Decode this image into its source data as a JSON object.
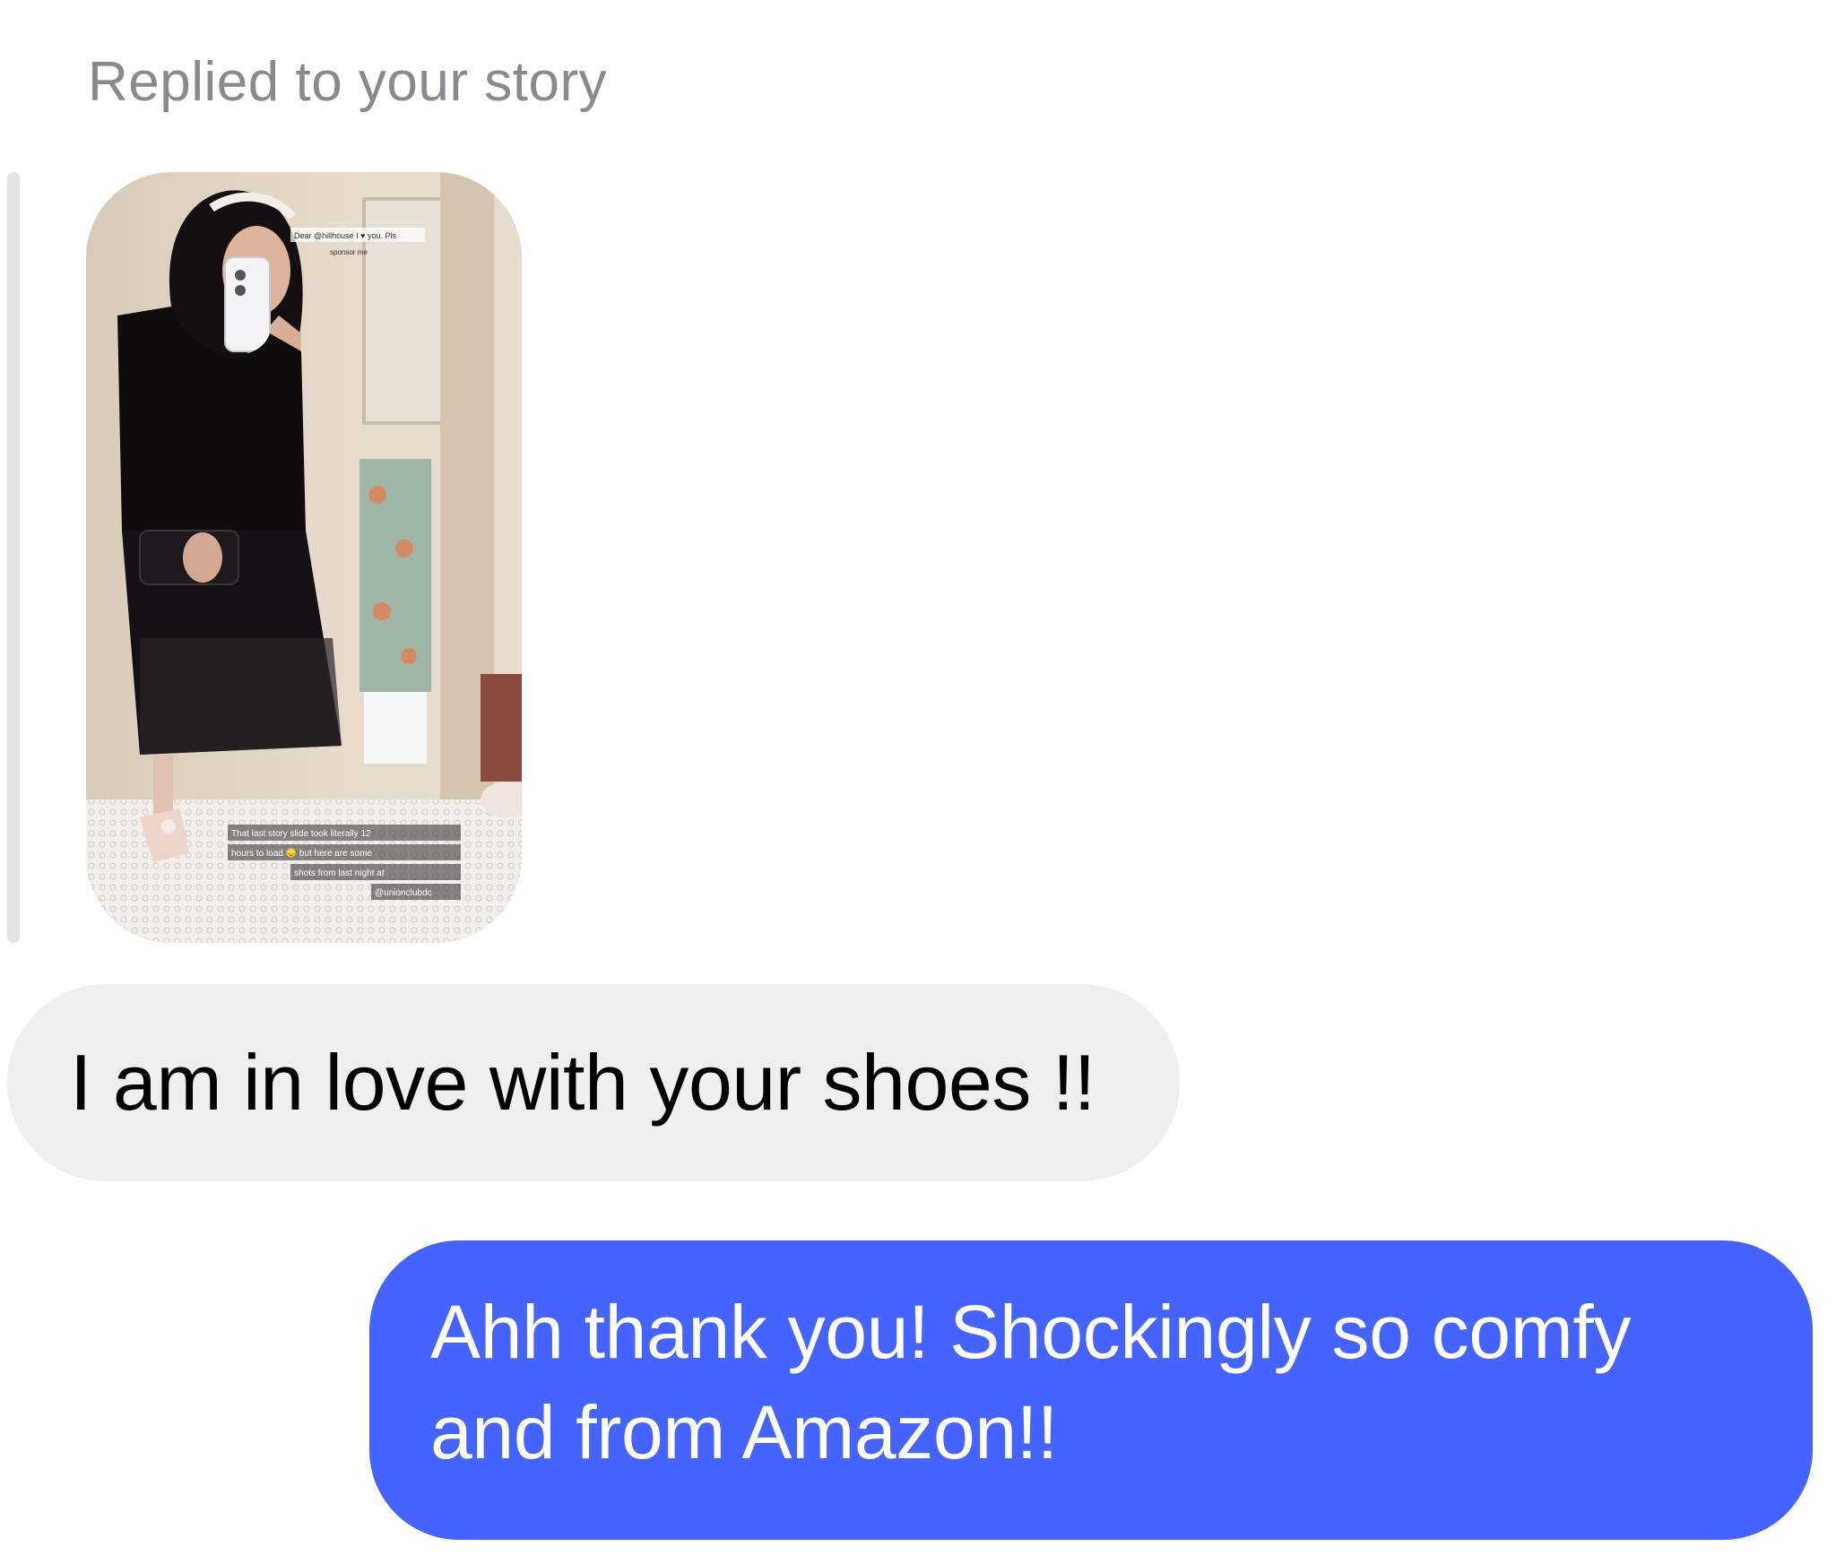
{
  "thread": {
    "reply_label": "Replied to your story",
    "incoming_message": "I am in love with your shoes !!",
    "outgoing_message": "Ahh thank you! Shockingly so comfy and from Amazon!!"
  },
  "story": {
    "top_caption_line1": "Dear @hillhouse I ♥ you. Pls",
    "top_caption_line2": "sponsor me",
    "bottom_caption_line1": "That last story slide took literally 12",
    "bottom_caption_line2": "hours to load 😞 but here are some",
    "bottom_caption_line3": "shots from last night at",
    "bottom_caption_line4": "@unionclubdc"
  },
  "colors": {
    "outgoing_bubble": "#4563fe",
    "incoming_bubble": "#efefef",
    "label_gray": "#8a8a8e"
  }
}
